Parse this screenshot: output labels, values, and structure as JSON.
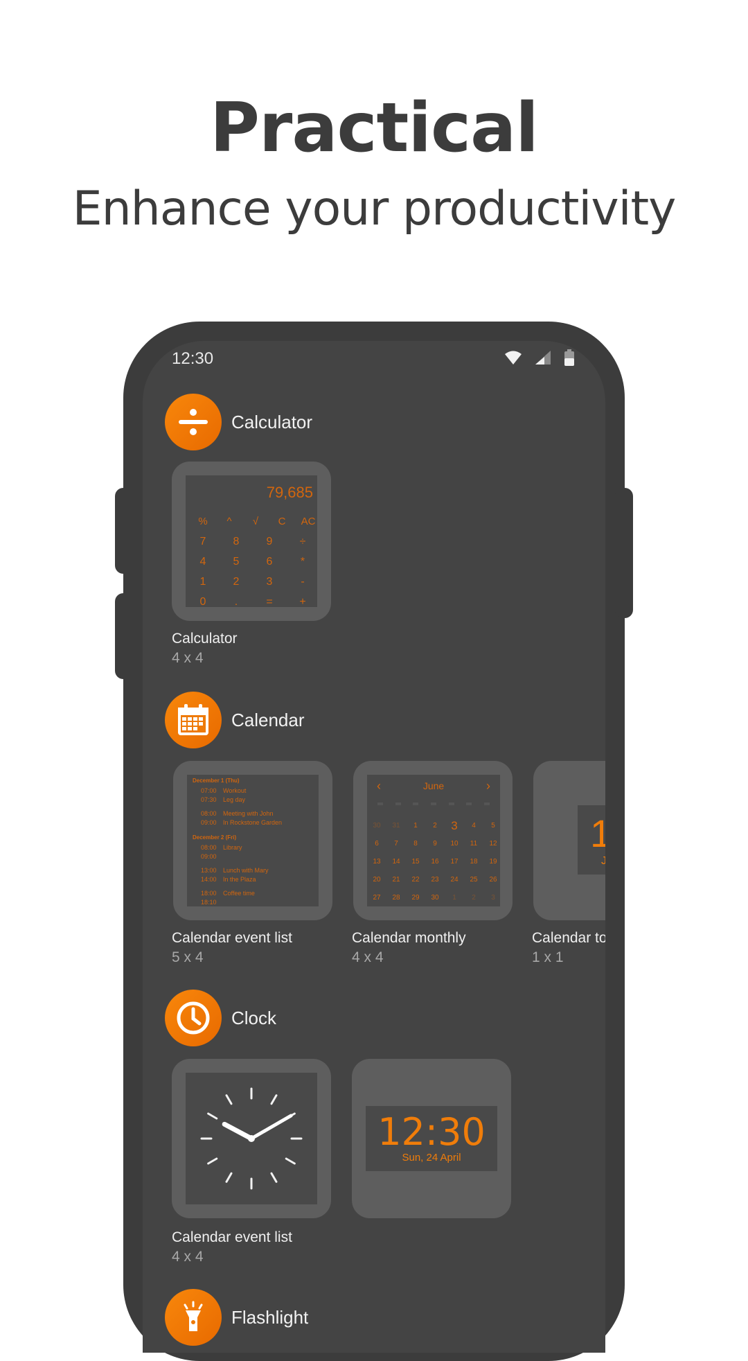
{
  "hero": {
    "title": "Practical",
    "subtitle": "Enhance your productivity"
  },
  "status_bar": {
    "time": "12:30",
    "icons": [
      "wifi-icon",
      "signal-icon",
      "battery-icon"
    ]
  },
  "colors": {
    "accent": "#f07d0a",
    "screen": "#444444",
    "card": "#5e5e5e",
    "widget_text": "#d2660e"
  },
  "sections": {
    "calculator": {
      "title": "Calculator",
      "icon": "divide-icon",
      "widgets": [
        {
          "name": "Calculator",
          "size": "4 x 4"
        }
      ],
      "preview": {
        "display": "79,685",
        "rows": [
          [
            "%",
            "^",
            "√",
            "C",
            "AC"
          ],
          [
            "7",
            "8",
            "9",
            "÷"
          ],
          [
            "4",
            "5",
            "6",
            "*"
          ],
          [
            "1",
            "2",
            "3",
            "-"
          ],
          [
            "0",
            ".",
            "=",
            "+"
          ]
        ]
      }
    },
    "calendar": {
      "title": "Calendar",
      "icon": "calendar-icon",
      "widgets": [
        {
          "name": "Calendar event list",
          "size": "5 x 4"
        },
        {
          "name": "Calendar monthly",
          "size": "4 x 4"
        },
        {
          "name": "Calendar to",
          "size": "1 x 1"
        }
      ],
      "event_list": {
        "days": [
          {
            "header": "December 1 (Thu)",
            "events": [
              {
                "start": "07:00",
                "end": "07:30",
                "title": "Workout",
                "place": "Leg day"
              },
              {
                "start": "08:00",
                "end": "09:00",
                "title": "Meeting with John",
                "place": "In Rockstone Garden"
              }
            ]
          },
          {
            "header": "December 2 (Fri)",
            "events": [
              {
                "start": "08:00",
                "end": "09:00",
                "title": "Library",
                "place": ""
              },
              {
                "start": "13:00",
                "end": "14:00",
                "title": "Lunch with Mary",
                "place": "In the Plaza"
              },
              {
                "start": "18:00",
                "end": "18:10",
                "title": "Coffee time",
                "place": ""
              }
            ]
          }
        ]
      },
      "monthly": {
        "month": "June",
        "today": "3",
        "weeks": [
          [
            "30",
            "31",
            "1",
            "2",
            "3",
            "4",
            "5"
          ],
          [
            "6",
            "7",
            "8",
            "9",
            "10",
            "11",
            "12"
          ],
          [
            "13",
            "14",
            "15",
            "16",
            "17",
            "18",
            "19"
          ],
          [
            "20",
            "21",
            "22",
            "23",
            "24",
            "25",
            "26"
          ],
          [
            "27",
            "28",
            "29",
            "30",
            "1",
            "2",
            "3"
          ]
        ]
      },
      "today_widget": {
        "day": "1",
        "month": "J"
      }
    },
    "clock": {
      "title": "Clock",
      "icon": "clock-icon",
      "widgets": [
        {
          "name": "Calendar event list",
          "size": "4 x 4"
        }
      ],
      "digital": {
        "time": "12:30",
        "date": "Sun, 24 April"
      }
    },
    "flashlight": {
      "title": "Flashlight",
      "icon": "flashlight-icon"
    }
  }
}
